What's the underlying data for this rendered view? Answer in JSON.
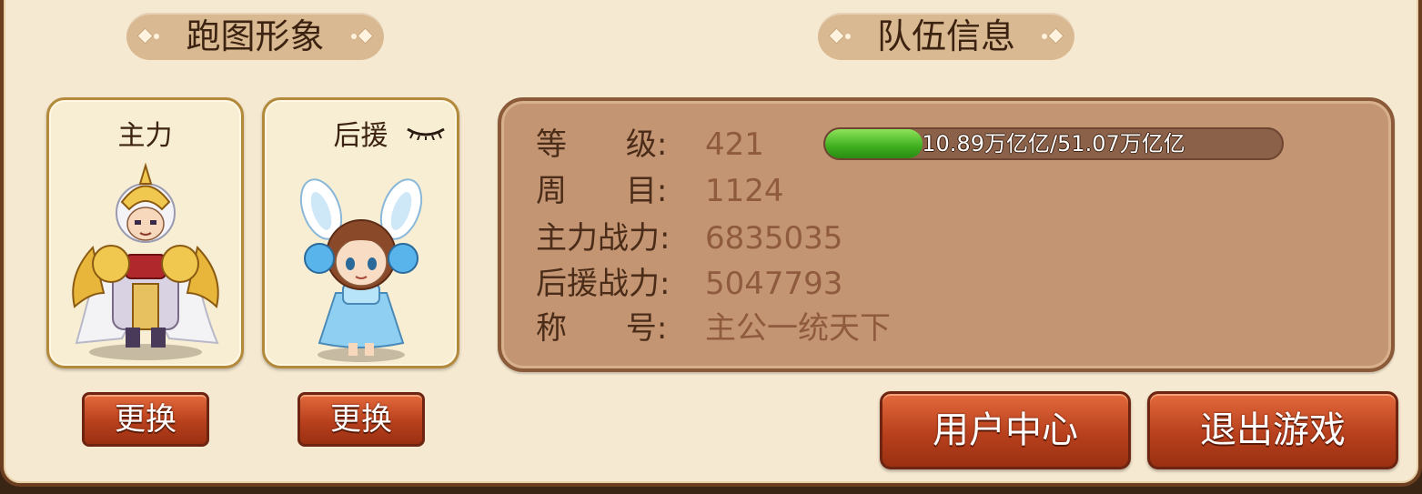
{
  "sections": {
    "avatar_title": "跑图形象",
    "team_title": "队伍信息"
  },
  "cards": {
    "main_label": "主力",
    "support_label": "后援"
  },
  "buttons": {
    "change_main": "更换",
    "change_support": "更换",
    "user_center": "用户中心",
    "exit_game": "退出游戏"
  },
  "team_info": {
    "level_label": "等      级:",
    "level_value": "421",
    "exp_text": "10.89万亿亿/51.07万亿亿",
    "exp_progress": 0.213,
    "round_label": "周      目:",
    "round_value": "1124",
    "main_power_label": "主力战力:",
    "main_power_value": "6835035",
    "support_power_label": "后援战力:",
    "support_power_value": "5047793",
    "title_label": "称      号:",
    "title_value": "主公一统天下"
  },
  "colors": {
    "panel_bg": "#f6e9d1",
    "info_bg": "#c39573",
    "button_red": "#b8401d",
    "exp_green": "#3eae1f"
  },
  "icons": {
    "support_card_toggle": "eye-closed-icon"
  }
}
